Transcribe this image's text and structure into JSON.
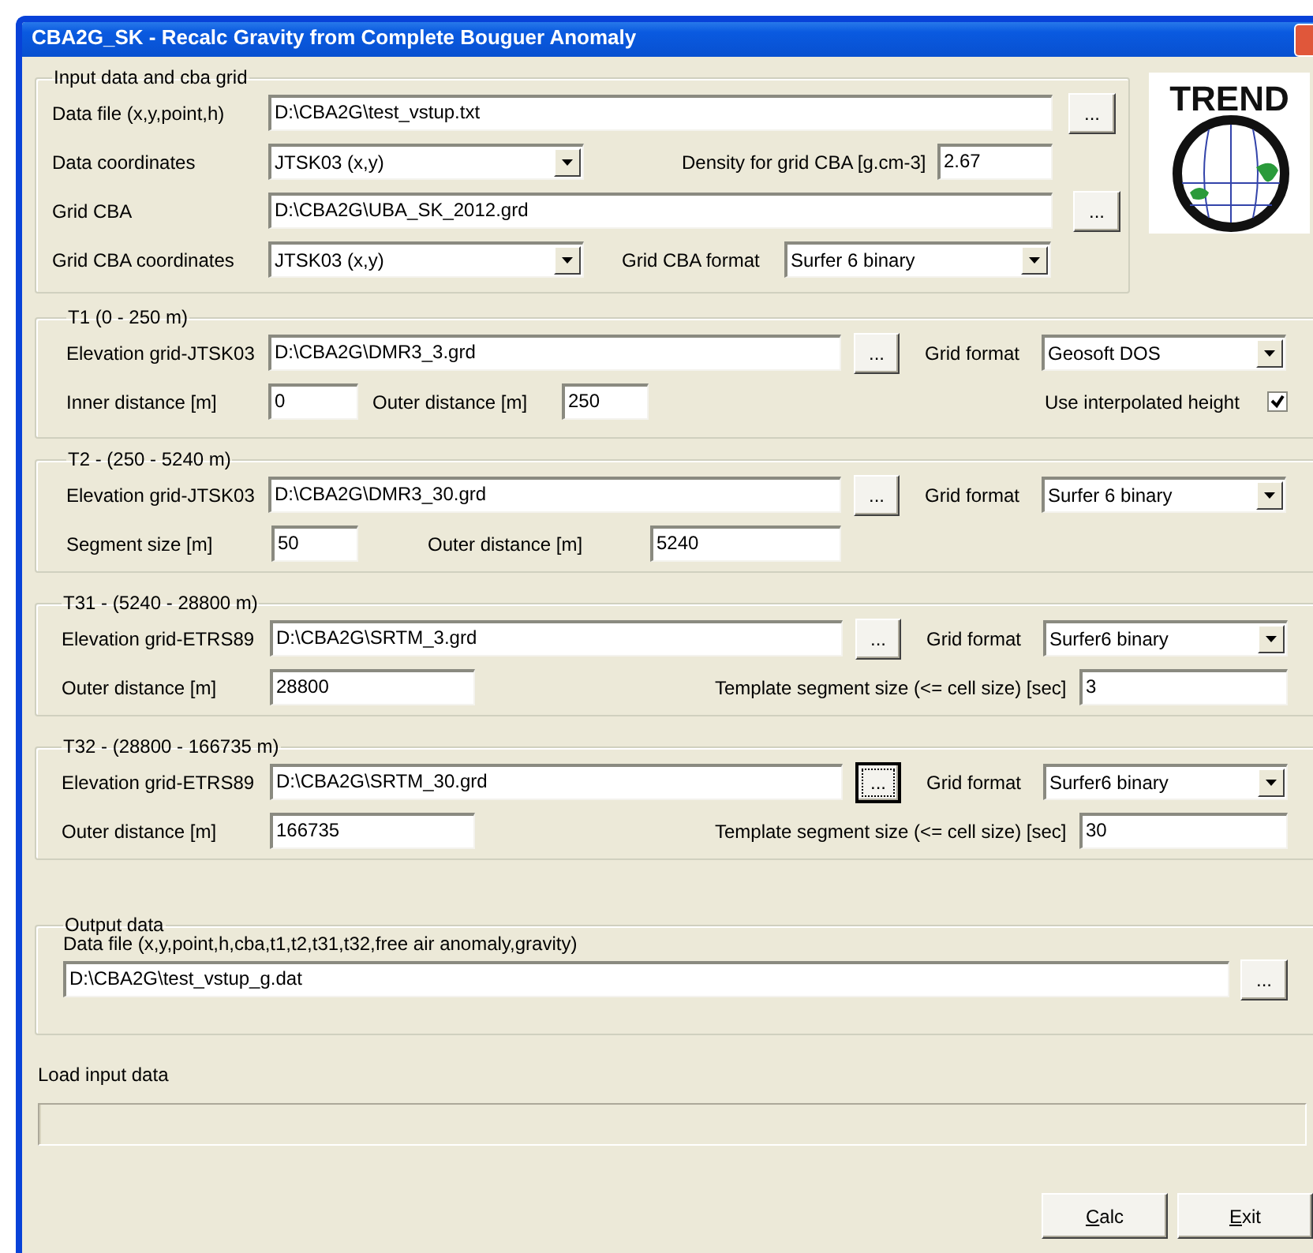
{
  "window": {
    "title": "CBA2G_SK - Recalc Gravity from Complete Bouguer Anomaly"
  },
  "logo": {
    "text": "TREND"
  },
  "input_group": {
    "title": "Input data and cba grid",
    "data_file": {
      "label": "Data file (x,y,point,h)",
      "value": "D:\\CBA2G\\test_vstup.txt",
      "browse": {
        "text": "...",
        "focused": false
      }
    },
    "data_coordinates": {
      "label": "Data coordinates",
      "value": "JTSK03 (x,y)"
    },
    "density": {
      "label": "Density for grid CBA [g.cm-3]",
      "value": "2.67"
    },
    "grid_cba": {
      "label": "Grid CBA",
      "value": "D:\\CBA2G\\UBA_SK_2012.grd",
      "browse": {
        "text": "...",
        "focused": false
      }
    },
    "grid_cba_coordinates": {
      "label": "Grid CBA coordinates",
      "value": "JTSK03 (x,y)"
    },
    "grid_cba_format": {
      "label": "Grid CBA format",
      "value": "Surfer 6 binary"
    }
  },
  "t1": {
    "title": "T1 (0 - 250 m)",
    "elevation": {
      "label": "Elevation grid-JTSK03",
      "value": "D:\\CBA2G\\DMR3_3.grd",
      "browse": {
        "text": "...",
        "focused": false
      }
    },
    "grid_format": {
      "label": "Grid format",
      "value": "Geosoft DOS"
    },
    "inner_distance": {
      "label": "Inner distance [m]",
      "value": "0"
    },
    "outer_distance": {
      "label": "Outer distance [m]",
      "value": "250"
    },
    "interpolated": {
      "label": "Use interpolated height",
      "checked": true
    }
  },
  "t2": {
    "title": "T2 - (250 - 5240 m)",
    "elevation": {
      "label": "Elevation grid-JTSK03",
      "value": "D:\\CBA2G\\DMR3_30.grd",
      "browse": {
        "text": "...",
        "focused": false
      }
    },
    "grid_format": {
      "label": "Grid format",
      "value": "Surfer 6 binary"
    },
    "segment_size": {
      "label": "Segment size [m]",
      "value": "50"
    },
    "outer_distance": {
      "label": "Outer distance [m]",
      "value": "5240"
    }
  },
  "t31": {
    "title": "T31  - (5240 - 28800 m)",
    "elevation": {
      "label": "Elevation grid-ETRS89",
      "value": "D:\\CBA2G\\SRTM_3.grd",
      "browse": {
        "text": "...",
        "focused": false
      }
    },
    "grid_format": {
      "label": "Grid format",
      "value": "Surfer6 binary"
    },
    "outer_distance": {
      "label": "Outer distance [m]",
      "value": "28800"
    },
    "template": {
      "label": "Template segment size (<= cell size) [sec]",
      "value": "3"
    }
  },
  "t32": {
    "title": "T32 - (28800 - 166735 m)",
    "elevation": {
      "label": "Elevation grid-ETRS89",
      "value": "D:\\CBA2G\\SRTM_30.grd",
      "browse": {
        "text": "...",
        "focused": true
      }
    },
    "grid_format": {
      "label": "Grid format",
      "value": "Surfer6 binary"
    },
    "outer_distance": {
      "label": "Outer distance [m]",
      "value": "166735"
    },
    "template": {
      "label": "Template segment size (<=  cell size) [sec]",
      "value": "30"
    }
  },
  "output_group": {
    "title": "Output data",
    "data_file": {
      "label": "Data file (x,y,point,h,cba,t1,t2,t31,t32,free air anomaly,gravity)",
      "value": "D:\\CBA2G\\test_vstup_g.dat",
      "browse": {
        "text": "...",
        "focused": false
      }
    }
  },
  "progress": {
    "label": "Load input data",
    "level": 0
  },
  "buttons": [
    {
      "text": "Calc"
    },
    {
      "text": "Exit"
    }
  ]
}
